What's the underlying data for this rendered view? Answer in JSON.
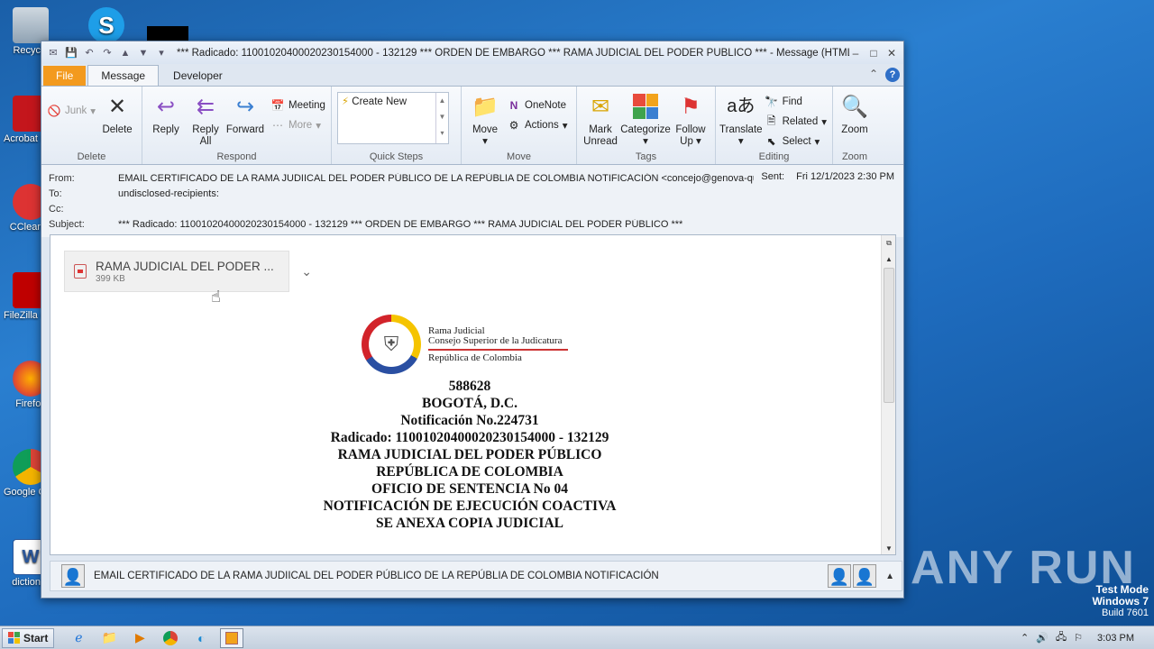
{
  "desktop": {
    "icons": [
      "Recycle",
      "Acrobat Reader",
      "CCleaner",
      "FileZilla Client",
      "Firefox",
      "Google Chrome",
      "dictionar"
    ],
    "watermark": "ANY RUN",
    "testmode": {
      "line1": "Test Mode",
      "line2": "Windows 7",
      "line3": "Build 7601"
    }
  },
  "window": {
    "title": "*** Radicado: 11001020400020230154000 - 132129 *** ORDEN DE EMBARGO *** RAMA JUDICIAL DEL PODER PÚBLICO *** - Message (HTML)",
    "tabs": {
      "file": "File",
      "message": "Message",
      "developer": "Developer"
    }
  },
  "ribbon": {
    "delete_group": {
      "junk": "Junk",
      "delete": "Delete",
      "label": "Delete"
    },
    "respond_group": {
      "reply": "Reply",
      "reply_all_1": "Reply",
      "reply_all_2": "All",
      "forward": "Forward",
      "meeting": "Meeting",
      "more": "More",
      "label": "Respond"
    },
    "quick_steps": {
      "create_new": "Create New",
      "label": "Quick Steps"
    },
    "move_group": {
      "move": "Move",
      "onenote": "OneNote",
      "actions": "Actions",
      "label": "Move"
    },
    "tags_group": {
      "mark_1": "Mark",
      "mark_2": "Unread",
      "categorize": "Categorize",
      "follow_1": "Follow",
      "follow_2": "Up",
      "label": "Tags"
    },
    "editing_group": {
      "translate": "Translate",
      "find": "Find",
      "related": "Related",
      "select": "Select",
      "label": "Editing"
    },
    "zoom_group": {
      "zoom": "Zoom",
      "label": "Zoom"
    }
  },
  "headers": {
    "from_label": "From:",
    "from_value": "EMAIL CERTIFICADO DE LA RAMA JUDIICAL DEL PODER PÚBLICO DE LA REPÚBLIA DE COLOMBIA NOTIFICACIÓN <concejo@genova-quindio.gov",
    "to_label": "To:",
    "to_value": "undisclosed-recipients:",
    "cc_label": "Cc:",
    "cc_value": "",
    "subject_label": "Subject:",
    "subject_value": "*** Radicado: 11001020400020230154000 - 132129 *** ORDEN DE EMBARGO *** RAMA JUDICIAL DEL PODER PÚBLICO ***",
    "sent_label": "Sent:",
    "sent_value": "Fri 12/1/2023 2:30 PM"
  },
  "attachment": {
    "name": "RAMA JUDICIAL DEL PODER ...",
    "size": "399 KB"
  },
  "logo": {
    "line1": "Rama Judicial",
    "line2": "Consejo Superior de la Judicatura",
    "line3": "República de Colombia"
  },
  "letter": [
    "588628",
    "BOGOTÁ, D.C.",
    "Notificación No.224731",
    "Radicado: 11001020400020230154000 - 132129",
    "RAMA JUDICIAL DEL PODER PÚBLICO",
    "REPÚBLICA DE COLOMBIA",
    "OFICIO DE SENTENCIA No 04",
    "NOTIFICACIÓN DE EJECUCIÓN COACTIVA",
    "SE ANEXA COPIA JUDICIAL"
  ],
  "people_pane": {
    "sender": "EMAIL CERTIFICADO DE LA RAMA JUDIICAL DEL PODER PÚBLICO DE LA REPÚBLIA DE COLOMBIA NOTIFICACIÓN"
  },
  "taskbar": {
    "start": "Start",
    "clock": "3:03 PM"
  }
}
